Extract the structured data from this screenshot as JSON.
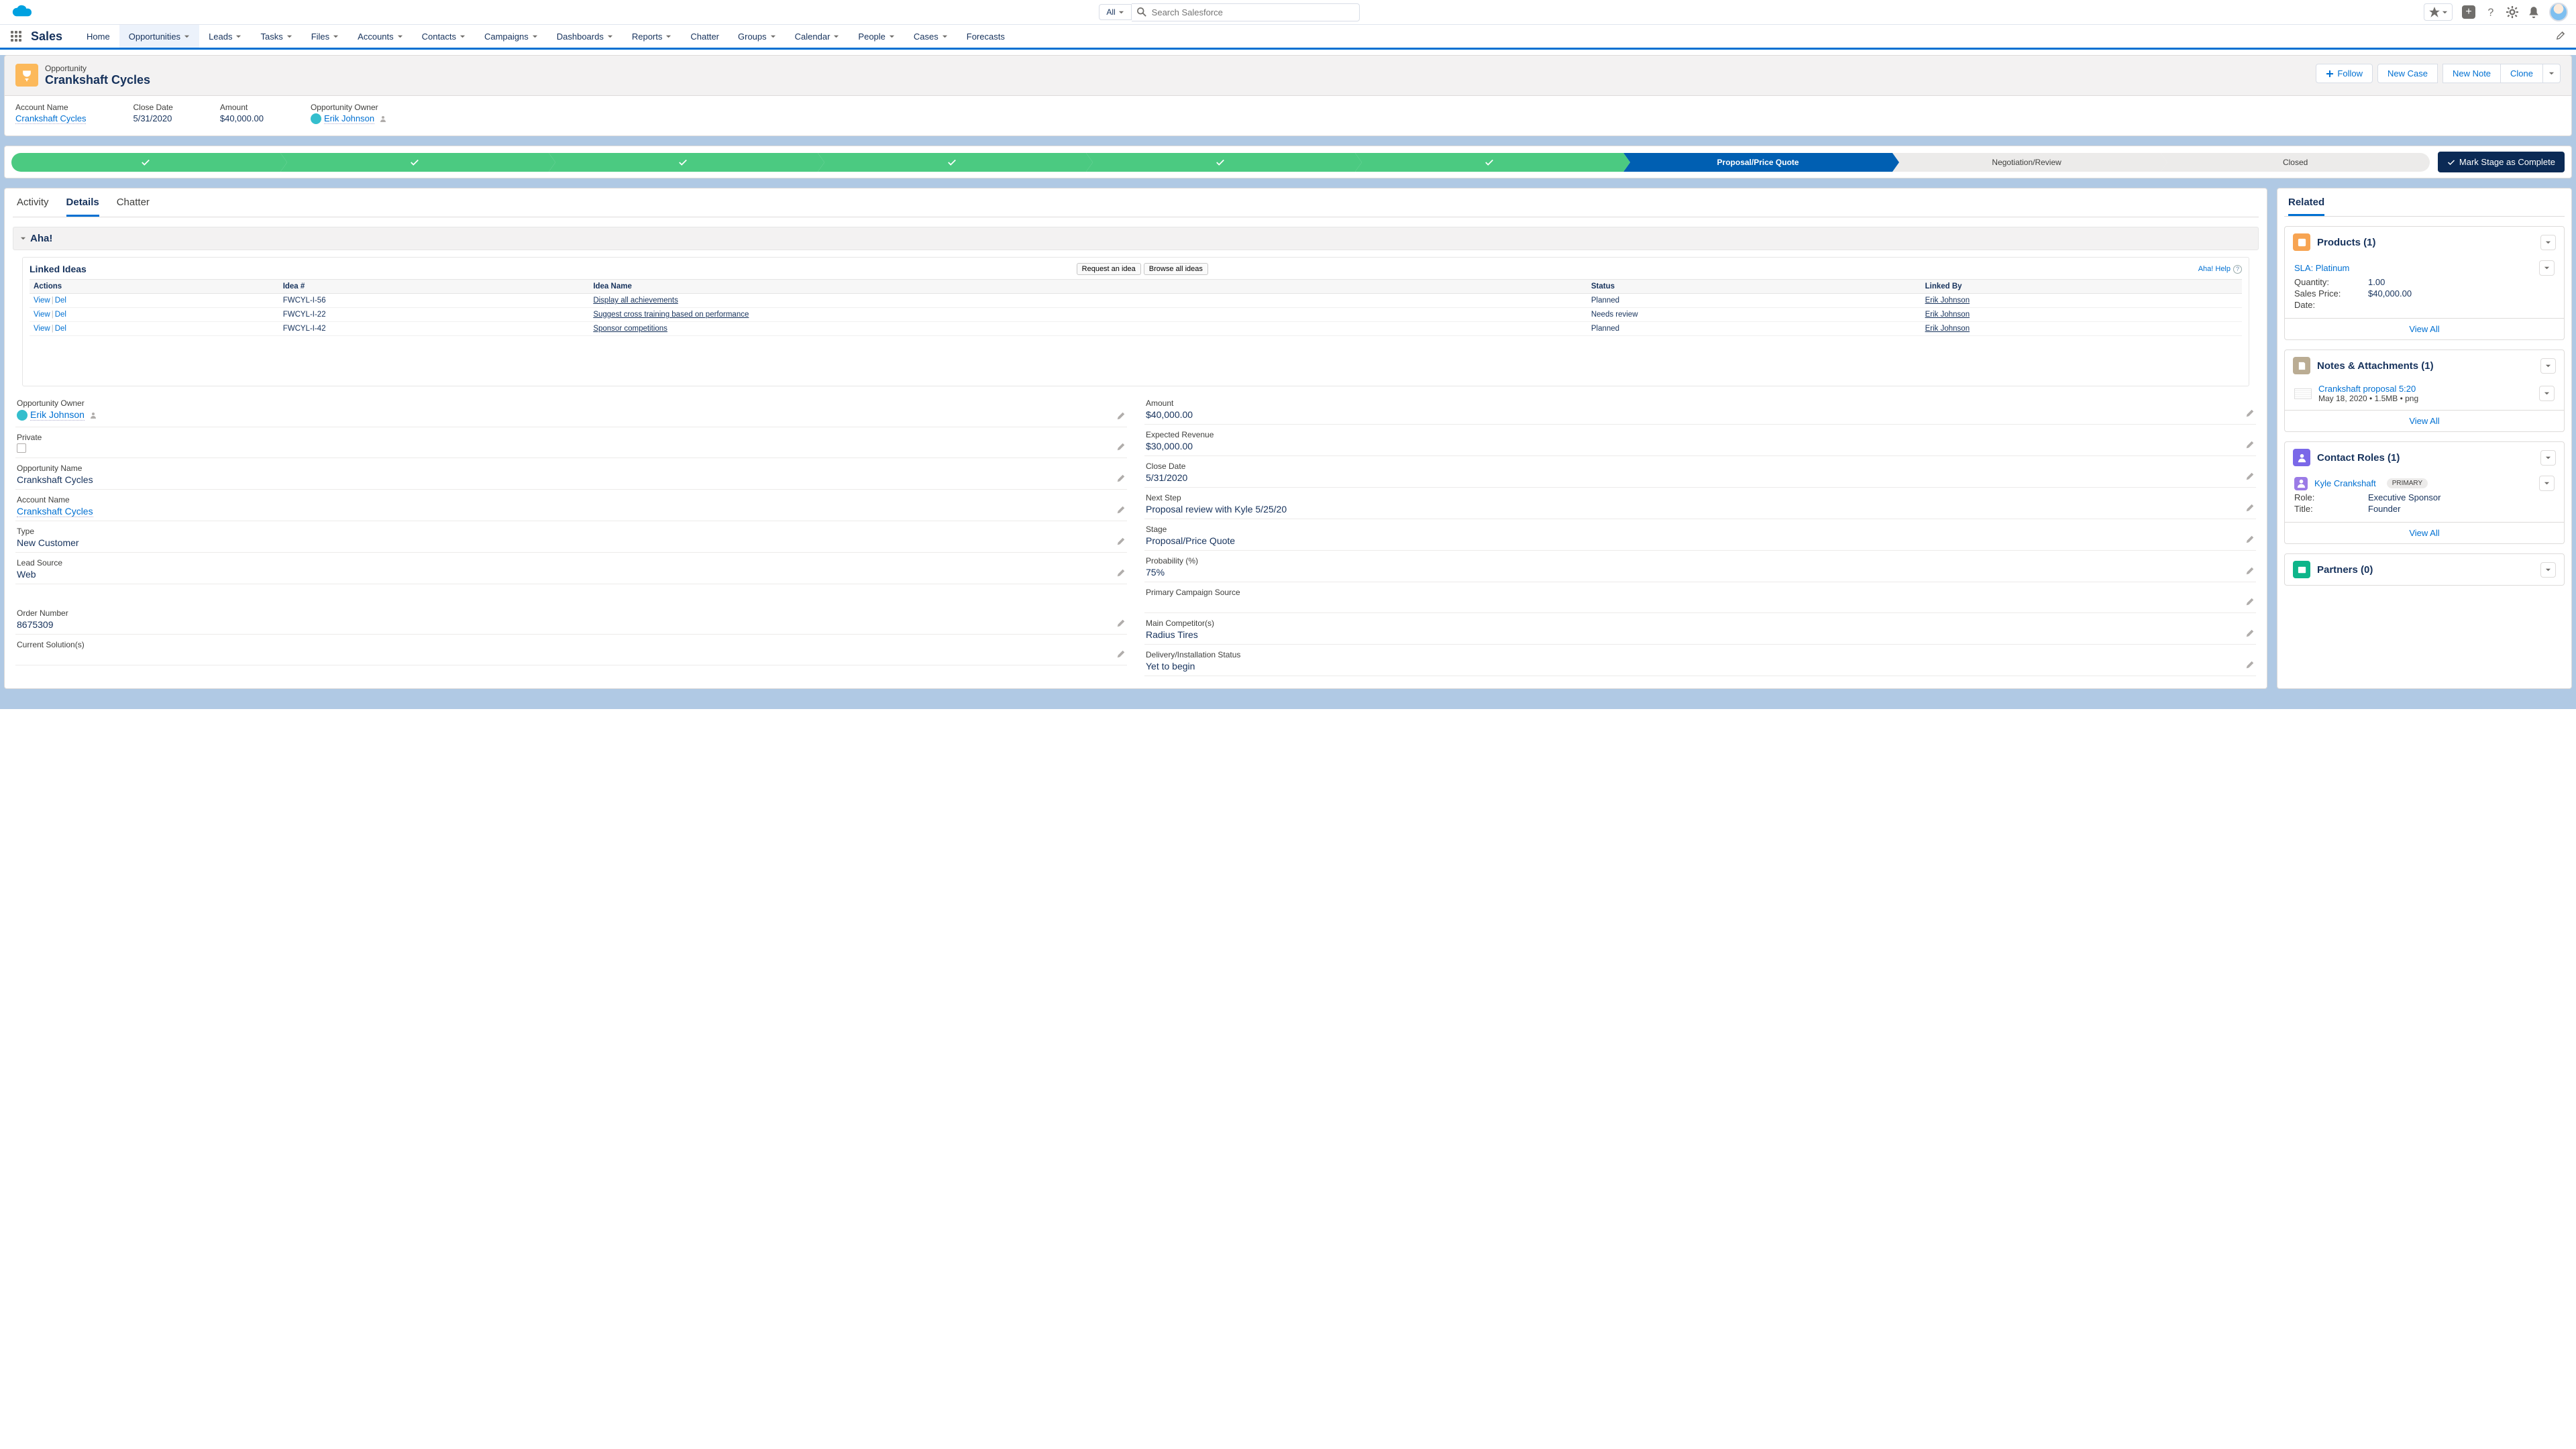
{
  "topbar": {
    "search_scope": "All",
    "search_placeholder": "Search Salesforce"
  },
  "nav": {
    "app_name": "Sales",
    "items": [
      "Home",
      "Opportunities",
      "Leads",
      "Tasks",
      "Files",
      "Accounts",
      "Contacts",
      "Campaigns",
      "Dashboards",
      "Reports",
      "Chatter",
      "Groups",
      "Calendar",
      "People",
      "Cases",
      "Forecasts"
    ],
    "active": "Opportunities"
  },
  "record": {
    "object_label": "Opportunity",
    "name": "Crankshaft Cycles",
    "actions": {
      "follow": "Follow",
      "new_case": "New Case",
      "new_note": "New Note",
      "clone": "Clone"
    },
    "summary": {
      "account_name": {
        "label": "Account Name",
        "value": "Crankshaft Cycles"
      },
      "close_date": {
        "label": "Close Date",
        "value": "5/31/2020"
      },
      "amount": {
        "label": "Amount",
        "value": "$40,000.00"
      },
      "owner": {
        "label": "Opportunity Owner",
        "value": "Erik Johnson"
      }
    }
  },
  "path": {
    "current": "Proposal/Price Quote",
    "open": [
      "Negotiation/Review",
      "Closed"
    ],
    "mark_label": "Mark Stage as Complete"
  },
  "tabs": {
    "activity": "Activity",
    "details": "Details",
    "chatter": "Chatter"
  },
  "aha": {
    "section_title": "Aha!",
    "linked_ideas_title": "Linked Ideas",
    "request_btn": "Request an idea",
    "browse_btn": "Browse all ideas",
    "help": "Aha! Help",
    "cols": {
      "actions": "Actions",
      "idea_num": "Idea #",
      "idea_name": "Idea Name",
      "status": "Status",
      "linked_by": "Linked By"
    },
    "action_view": "View",
    "action_del": "Del",
    "rows": [
      {
        "num": "FWCYL-I-56",
        "name": "Display all achievements",
        "status": "Planned",
        "by": "Erik Johnson"
      },
      {
        "num": "FWCYL-I-22",
        "name": "Suggest cross training based on performance",
        "status": "Needs review",
        "by": "Erik Johnson"
      },
      {
        "num": "FWCYL-I-42",
        "name": "Sponsor competitions",
        "status": "Planned",
        "by": "Erik Johnson"
      }
    ]
  },
  "details": {
    "left": [
      {
        "label": "Opportunity Owner",
        "value": "Erik Johnson",
        "link": true,
        "person": true,
        "change": true
      },
      {
        "label": "Private",
        "value": "",
        "checkbox": true
      },
      {
        "label": "Opportunity Name",
        "value": "Crankshaft Cycles"
      },
      {
        "label": "Account Name",
        "value": "Crankshaft Cycles",
        "link": true
      },
      {
        "label": "Type",
        "value": "New Customer"
      },
      {
        "label": "Lead Source",
        "value": "Web"
      },
      {
        "label": "",
        "value": ""
      },
      {
        "label": "Order Number",
        "value": "8675309"
      },
      {
        "label": "Current Solution(s)",
        "value": ""
      }
    ],
    "right": [
      {
        "label": "Amount",
        "value": "$40,000.00"
      },
      {
        "label": "Expected Revenue",
        "value": "$30,000.00"
      },
      {
        "label": "Close Date",
        "value": "5/31/2020"
      },
      {
        "label": "Next Step",
        "value": "Proposal review with Kyle 5/25/20"
      },
      {
        "label": "Stage",
        "value": "Proposal/Price Quote"
      },
      {
        "label": "Probability (%)",
        "value": "75%"
      },
      {
        "label": "Primary Campaign Source",
        "value": ""
      },
      {
        "label": "Main Competitor(s)",
        "value": "Radius Tires"
      },
      {
        "label": "Delivery/Installation Status",
        "value": "Yet to begin"
      }
    ]
  },
  "related": {
    "tab": "Related",
    "view_all": "View All",
    "products": {
      "title": "Products (1)",
      "item": {
        "name": "SLA: Platinum",
        "qty_l": "Quantity:",
        "qty": "1.00",
        "price_l": "Sales Price:",
        "price": "$40,000.00",
        "date_l": "Date:"
      }
    },
    "notes": {
      "title": "Notes & Attachments (1)",
      "item": {
        "name": "Crankshaft proposal 5:20",
        "meta": "May 18, 2020  •  1.5MB  •  png"
      }
    },
    "contacts": {
      "title": "Contact Roles (1)",
      "item": {
        "name": "Kyle Crankshaft",
        "badge": "PRIMARY",
        "role_l": "Role:",
        "role": "Executive Sponsor",
        "title_l": "Title:",
        "title_v": "Founder"
      }
    },
    "partners": {
      "title": "Partners (0)"
    }
  }
}
